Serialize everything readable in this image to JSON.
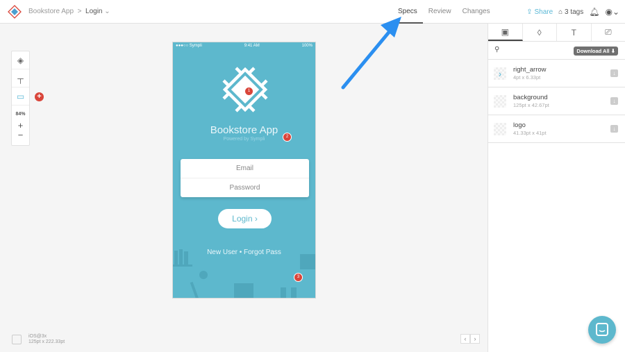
{
  "header": {
    "breadcrumb": {
      "project": "Bookstore App",
      "separator": ">",
      "screen": "Login"
    },
    "tabs": [
      {
        "label": "Specs",
        "active": true
      },
      {
        "label": "Review"
      },
      {
        "label": "Changes"
      }
    ],
    "share_label": "Share",
    "tags_label": "3 tags"
  },
  "toolbar": {
    "zoom": "84%",
    "zoom_in": "+",
    "zoom_out": "−"
  },
  "panel": {
    "tabs": [
      "assets-icon",
      "color-drop-icon",
      "text-icon",
      "comments-icon"
    ],
    "download_all": "Download All ⬇",
    "assets": [
      {
        "name": "right_arrow",
        "size": "4pt x 6.33pt"
      },
      {
        "name": "background",
        "size": "125pt x 42.67pt"
      },
      {
        "name": "logo",
        "size": "41.33pt x 41pt"
      }
    ]
  },
  "phone": {
    "carrier": "●●●○○ Sympli",
    "time": "9:41 AM",
    "battery": "100%",
    "title": "Bookstore App",
    "subtitle": "Powered by Sympli",
    "email_placeholder": "Email",
    "password_placeholder": "Password",
    "login": "Login ›",
    "links": "New User • Forgot Pass",
    "pins": [
      "1",
      "2",
      "3"
    ]
  },
  "footer": {
    "device": "iOS@3x",
    "size": "125pt x 222.33pt",
    "prev": "‹",
    "next": "›"
  },
  "colors": {
    "accent": "#5bb8d6",
    "phone_bg": "#5db8cd",
    "pin": "#d9453a",
    "arrow": "#2b8ff0"
  }
}
